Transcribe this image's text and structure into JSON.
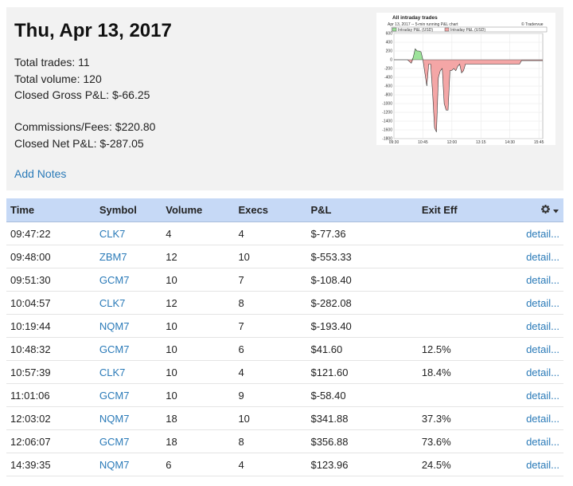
{
  "day": {
    "title": "Thu, Apr 13, 2017",
    "total_trades": "Total trades: 11",
    "total_volume": "Total volume: 120",
    "closed_gross": "Closed Gross P&L: $-66.25",
    "commissions": "Commissions/Fees: $220.80",
    "closed_net": "Closed Net P&L: $-287.05",
    "add_notes": "Add Notes"
  },
  "chart": {
    "title": "All intraday trades",
    "subtitle": "Apr 13, 2017 -- 5-min running P&L chart",
    "credit": "© Tradervue",
    "legend": [
      "Intraday P&L (USD)",
      "Intraday P&L (USD)"
    ],
    "pos_color": "#9de39a",
    "neg_color": "#f4a6a6",
    "y_ticks": [
      "600",
      "400",
      "200",
      "0",
      "-200",
      "-400",
      "-600",
      "-800",
      "-1000",
      "-1200",
      "-1400",
      "-1600",
      "-1800"
    ],
    "x_ticks": [
      "09:30",
      "10:45",
      "12:00",
      "13:15",
      "14:30",
      "15:45"
    ]
  },
  "chart_data": {
    "type": "area",
    "title": "All intraday trades",
    "x": [
      "09:30",
      "09:35",
      "09:40",
      "09:45",
      "09:50",
      "09:55",
      "10:00",
      "10:05",
      "10:10",
      "10:15",
      "10:20",
      "10:25",
      "10:30",
      "10:35",
      "10:40",
      "10:45",
      "10:50",
      "10:55",
      "11:00",
      "11:05",
      "11:10",
      "11:15",
      "11:20",
      "11:25",
      "11:30",
      "11:35",
      "11:40",
      "11:45",
      "11:50",
      "11:55",
      "12:00",
      "12:05",
      "12:10",
      "12:15",
      "12:20",
      "12:25",
      "12:30",
      "12:35",
      "12:40",
      "12:45",
      "12:50",
      "12:55",
      "13:00",
      "13:05",
      "13:10",
      "13:15",
      "13:20",
      "13:25",
      "13:30",
      "13:35",
      "13:40",
      "13:45",
      "13:50",
      "13:55",
      "14:00",
      "14:05",
      "14:10",
      "14:15",
      "14:20",
      "14:25",
      "14:30",
      "14:35",
      "14:40",
      "14:45",
      "14:50",
      "14:55",
      "15:00",
      "15:05",
      "15:10",
      "15:15",
      "15:20",
      "15:25",
      "15:30",
      "15:35",
      "15:40",
      "15:45",
      "15:50",
      "15:55"
    ],
    "series": [
      {
        "name": "Intraday P&L (USD)",
        "values": [
          0,
          0,
          0,
          0,
          0,
          0,
          0,
          0,
          -40,
          -80,
          60,
          250,
          200,
          200,
          180,
          0,
          -300,
          -600,
          -100,
          -100,
          -750,
          -1550,
          -1650,
          -400,
          -250,
          -200,
          -1000,
          -1150,
          -1150,
          -250,
          -240,
          -200,
          -250,
          -150,
          -100,
          -300,
          -250,
          -100,
          -100,
          -100,
          -100,
          -100,
          -100,
          -100,
          -100,
          -100,
          -100,
          -100,
          -100,
          -100,
          -100,
          -100,
          -100,
          -100,
          -100,
          -100,
          -100,
          -100,
          -100,
          -100,
          -100,
          -100,
          -100,
          -100,
          -100,
          -100,
          -20,
          -20,
          -20,
          -20,
          -20,
          -20,
          -20,
          -20,
          -20,
          -20,
          -20,
          -20
        ]
      }
    ],
    "ylim": [
      -1800,
      600
    ],
    "grid": true,
    "legend": "top-left"
  },
  "table": {
    "gear_icon": "gear-icon",
    "columns": [
      "Time",
      "Symbol",
      "Volume",
      "Execs",
      "P&L",
      "Exit Eff"
    ],
    "rows": [
      {
        "time": "09:47:22",
        "symbol": "CLK7",
        "volume": "4",
        "execs": "4",
        "pnl": "$-77.36",
        "exit": "",
        "detail": "detail..."
      },
      {
        "time": "09:48:00",
        "symbol": "ZBM7",
        "volume": "12",
        "execs": "10",
        "pnl": "$-553.33",
        "exit": "",
        "detail": "detail..."
      },
      {
        "time": "09:51:30",
        "symbol": "GCM7",
        "volume": "10",
        "execs": "7",
        "pnl": "$-108.40",
        "exit": "",
        "detail": "detail..."
      },
      {
        "time": "10:04:57",
        "symbol": "CLK7",
        "volume": "12",
        "execs": "8",
        "pnl": "$-282.08",
        "exit": "",
        "detail": "detail..."
      },
      {
        "time": "10:19:44",
        "symbol": "NQM7",
        "volume": "10",
        "execs": "7",
        "pnl": "$-193.40",
        "exit": "",
        "detail": "detail..."
      },
      {
        "time": "10:48:32",
        "symbol": "GCM7",
        "volume": "10",
        "execs": "6",
        "pnl": "$41.60",
        "exit": "12.5%",
        "detail": "detail..."
      },
      {
        "time": "10:57:39",
        "symbol": "CLK7",
        "volume": "10",
        "execs": "4",
        "pnl": "$121.60",
        "exit": "18.4%",
        "detail": "detail..."
      },
      {
        "time": "11:01:06",
        "symbol": "GCM7",
        "volume": "10",
        "execs": "9",
        "pnl": "$-58.40",
        "exit": "",
        "detail": "detail..."
      },
      {
        "time": "12:03:02",
        "symbol": "NQM7",
        "volume": "18",
        "execs": "10",
        "pnl": "$341.88",
        "exit": "37.3%",
        "detail": "detail..."
      },
      {
        "time": "12:06:07",
        "symbol": "GCM7",
        "volume": "18",
        "execs": "8",
        "pnl": "$356.88",
        "exit": "73.6%",
        "detail": "detail..."
      },
      {
        "time": "14:39:35",
        "symbol": "NQM7",
        "volume": "6",
        "execs": "4",
        "pnl": "$123.96",
        "exit": "24.5%",
        "detail": "detail..."
      }
    ]
  }
}
